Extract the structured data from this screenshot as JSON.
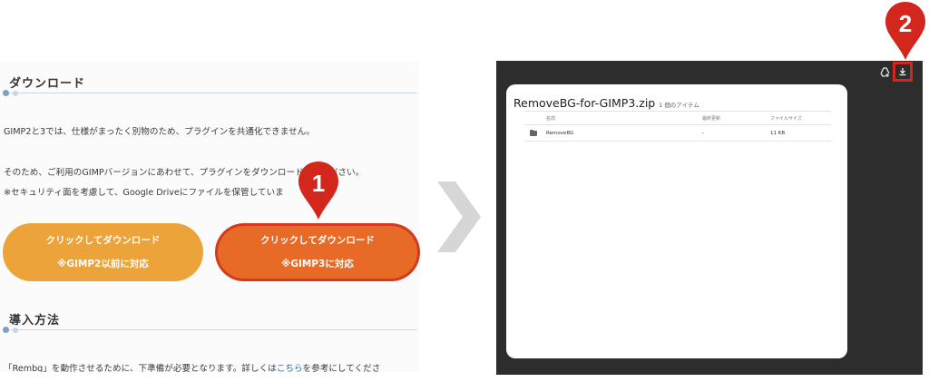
{
  "left": {
    "section1_title": "ダウンロード",
    "para1": "GIMP2と3では、仕様がまったく別物のため、プラグインを共通化できません。",
    "para2": "そのため、ご利用のGIMPバージョンにあわせて、プラグインをダウンロードしてください。",
    "para3": "※セキュリティ面を考慮して、Google Driveにファイルを保管していま",
    "button1": {
      "line1": "クリックしてダウンロード",
      "line2": "※GIMP2以前に対応"
    },
    "button2": {
      "line1": "クリックしてダウンロード",
      "line2": "※GIMP3に対応"
    },
    "section2_title": "導入方法",
    "para4_before": "「Rembg」を動作させるために、下準備が必要となります。詳しくは",
    "para4_link": "こちら",
    "para4_after": "を参考にしてくださ"
  },
  "markers": {
    "step1": "1",
    "step2": "2"
  },
  "colors": {
    "marker_red": "#d3271d",
    "btn_orange": "#eba33a",
    "btn_red": "#e86a27",
    "dark_bg": "#2d2d2d"
  },
  "drive": {
    "title": "RemoveBG-for-GIMP3.zip",
    "item_count": "1 個のアイテム",
    "columns": [
      "名前",
      "最終更新",
      "ファイルサイズ"
    ],
    "rows": [
      {
        "name": "RemoveBG",
        "modified": "-",
        "size": "11 KB",
        "icon": "folder-icon"
      }
    ],
    "toolbar_icons": [
      "add-to-drive-icon",
      "download-icon"
    ]
  }
}
